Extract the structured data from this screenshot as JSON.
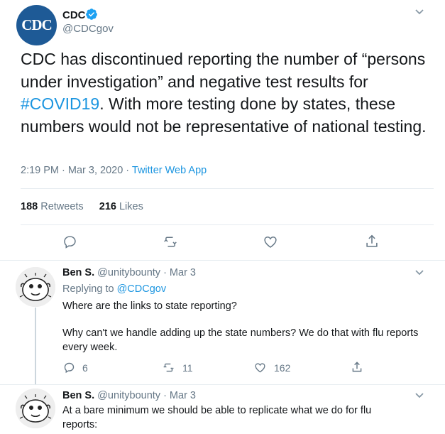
{
  "colors": {
    "accent": "#1b95e0",
    "muted": "#657786",
    "text": "#14171a",
    "divider": "#e6ecf0"
  },
  "main_tweet": {
    "avatar_text": "CDC",
    "name": "CDC",
    "handle": "@CDCgov",
    "text_before": "CDC has discontinued reporting the number of “persons under investigation” and negative test results for ",
    "hashtag": "#COVID19",
    "text_after": ". With more testing done by states, these numbers would not be representative of national testing.",
    "time": "2:19 PM · Mar 3, 2020 · ",
    "source": "Twitter Web App",
    "retweets_count": "188",
    "retweets_label": "Retweets",
    "likes_count": "216",
    "likes_label": "Likes",
    "icons": [
      "reply-icon",
      "retweet-icon",
      "like-icon",
      "share-icon"
    ]
  },
  "replies": [
    {
      "name": "Ben S.",
      "handle": "@unitybounty",
      "date": "· Mar 3",
      "replying_prefix": "Replying to ",
      "replying_to": "@CDCgov",
      "text1": "Where are the links to state reporting?",
      "text2": "Why can't we handle adding up the state numbers? We do that with flu reports every week.",
      "reply_count": "6",
      "retweet_count": "11",
      "like_count": "162"
    },
    {
      "name": "Ben S.",
      "handle": "@unitybounty",
      "date": "· Mar 3",
      "text1": "At a bare minimum we should be able to replicate what we do for flu reports:"
    }
  ]
}
